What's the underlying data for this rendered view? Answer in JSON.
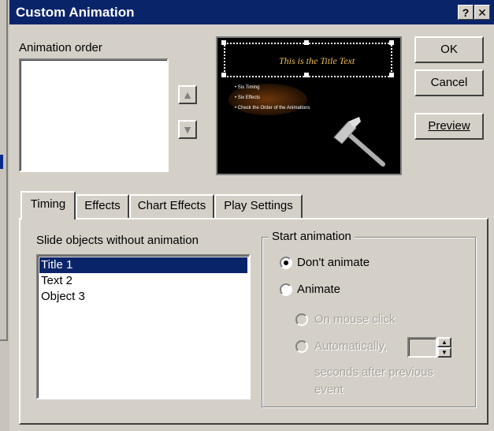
{
  "window": {
    "title": "Custom Animation",
    "help_label": "?",
    "close_label": "✕"
  },
  "animation_order": {
    "label": "Animation order",
    "label_u": "o",
    "items": [],
    "move_up_icon": "up-arrow",
    "move_down_icon": "down-arrow"
  },
  "preview_slide": {
    "title_text": "This is the Title Text",
    "bullets": [
      "Six Timing",
      "Six Effects",
      "Check the Order of the Animations"
    ],
    "picture": "hammer"
  },
  "buttons": {
    "ok": "OK",
    "cancel": "Cancel",
    "preview": "Preview",
    "preview_u": "P"
  },
  "tabs": [
    {
      "label": "Timing",
      "active": true
    },
    {
      "label": "Effects",
      "active": false
    },
    {
      "label": "Chart Effects",
      "active": false
    },
    {
      "label": "Play Settings",
      "active": false
    }
  ],
  "timing": {
    "objects_label": "Slide objects without animation",
    "objects_label_u": "S",
    "objects": [
      "Title 1",
      "Text 2",
      "Object 3"
    ],
    "selected_index": 0,
    "start_group_label": "Start animation",
    "dont_animate_label": "Don't animate",
    "animate_label": "Animate",
    "on_mouse_click_label": "On mouse click",
    "automatically_label": "Automatically,",
    "seconds_after_label": "seconds after previous",
    "event_label": "event",
    "selected_option": "dont_animate",
    "seconds_value": ""
  },
  "colors": {
    "titlebar": "#0a246a",
    "face": "#d4d0c8",
    "selection": "#0a246a"
  }
}
